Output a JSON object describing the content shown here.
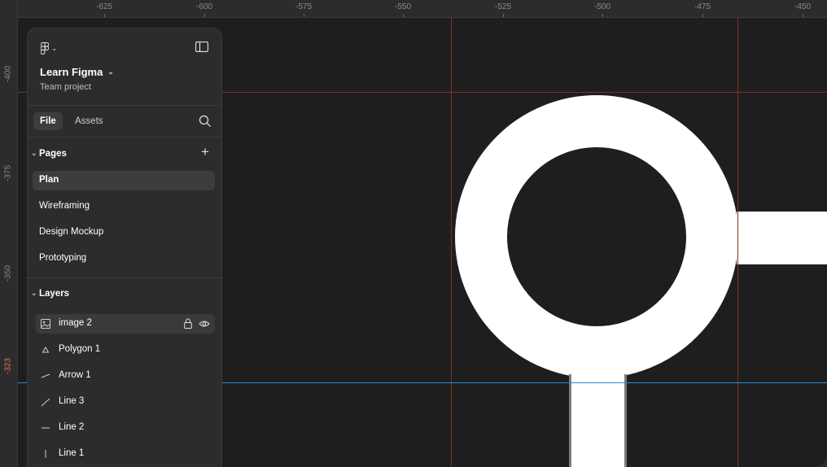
{
  "ruler": {
    "x_ticks": [
      "-625",
      "-600",
      "-575",
      "-550",
      "-525",
      "-500",
      "-475",
      "-450"
    ],
    "y_ticks": [
      "-400",
      "-375",
      "-350",
      "-323"
    ]
  },
  "colors": {
    "canvas": "#1e1e1e",
    "panel": "#2c2c2c",
    "guide_red": "#7a3525",
    "guide_blue": "#2b8cd8",
    "shape": "#ffffff"
  },
  "icons": {
    "logo": "figma-logo-icon",
    "sidebar": "sidebar-toggle-icon",
    "search": "search-icon",
    "add": "plus-icon",
    "image": "image-icon",
    "polygon": "polygon-icon",
    "arrow": "arrow-icon",
    "line": "line-icon",
    "lock": "lock-icon",
    "eye": "eye-icon"
  },
  "project": {
    "name": "Learn Figma",
    "subtitle": "Team project"
  },
  "tabs": {
    "file": "File",
    "assets": "Assets"
  },
  "pages": {
    "header": "Pages",
    "items": [
      {
        "label": "Plan",
        "selected": true
      },
      {
        "label": "Wireframing",
        "selected": false
      },
      {
        "label": "Design Mockup",
        "selected": false
      },
      {
        "label": "Prototyping",
        "selected": false
      }
    ]
  },
  "layers": {
    "header": "Layers",
    "items": [
      {
        "label": "image 2",
        "icon": "image-icon",
        "selected": true
      },
      {
        "label": "Polygon 1",
        "icon": "polygon-icon",
        "selected": false
      },
      {
        "label": "Arrow 1",
        "icon": "arrow-icon",
        "selected": false
      },
      {
        "label": "Line 3",
        "icon": "line-icon",
        "selected": false
      },
      {
        "label": "Line 2",
        "icon": "line-icon",
        "selected": false
      },
      {
        "label": "Line 1",
        "icon": "line-icon",
        "selected": false
      }
    ]
  }
}
